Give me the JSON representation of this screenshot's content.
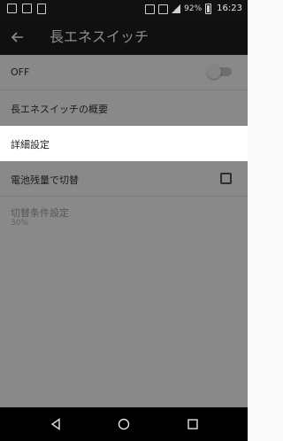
{
  "status_bar": {
    "battery_text": "92%",
    "time": "16:23"
  },
  "app_bar": {
    "title": "長エネスイッチ",
    "back_icon": "arrow-left-icon"
  },
  "settings": {
    "off_label": "OFF",
    "off_toggle_state": "off",
    "overview_label": "長エネスイッチの概要",
    "detail_label": "詳細設定",
    "battery_label": "電池残量で切替",
    "battery_checked": false,
    "condition_label": "切替条件設定",
    "condition_value": "30%"
  },
  "nav_bar": {
    "back_icon": "triangle-back-icon",
    "home_icon": "circle-home-icon",
    "recent_icon": "square-recents-icon"
  }
}
